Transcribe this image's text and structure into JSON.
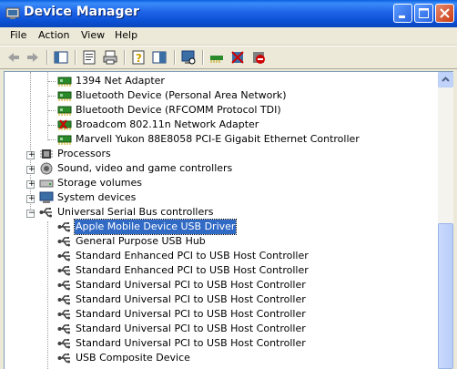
{
  "window": {
    "title": "Device Manager"
  },
  "menu": {
    "file": "File",
    "action": "Action",
    "view": "View",
    "help": "Help"
  },
  "toolbar": {
    "icons": [
      "back-arrow-icon",
      "forward-arrow-icon",
      "show-hide-console-tree-icon",
      "properties-icon",
      "print-icon",
      "help-icon",
      "export-list-icon",
      "scan-hardware-icon",
      "update-driver-icon",
      "uninstall-icon",
      "disable-icon"
    ]
  },
  "tree": {
    "network_children": [
      "1394 Net Adapter",
      "Bluetooth Device (Personal Area Network)",
      "Bluetooth Device (RFCOMM Protocol TDI)",
      "Broadcom 802.11n Network Adapter",
      "Marvell Yukon 88E8058 PCI-E Gigabit Ethernet Controller"
    ],
    "categories": {
      "processors": "Processors",
      "sound": "Sound, video and game controllers",
      "storage": "Storage volumes",
      "system": "System devices",
      "usb": "Universal Serial Bus controllers"
    },
    "usb_children": [
      "Apple Mobile Device USB Driver",
      "General Purpose USB Hub",
      "Standard Enhanced PCI to USB Host Controller",
      "Standard Enhanced PCI to USB Host Controller",
      "Standard Universal PCI to USB Host Controller",
      "Standard Universal PCI to USB Host Controller",
      "Standard Universal PCI to USB Host Controller",
      "Standard Universal PCI to USB Host Controller",
      "Standard Universal PCI to USB Host Controller",
      "USB Composite Device"
    ],
    "selected": "Apple Mobile Device USB Driver"
  }
}
